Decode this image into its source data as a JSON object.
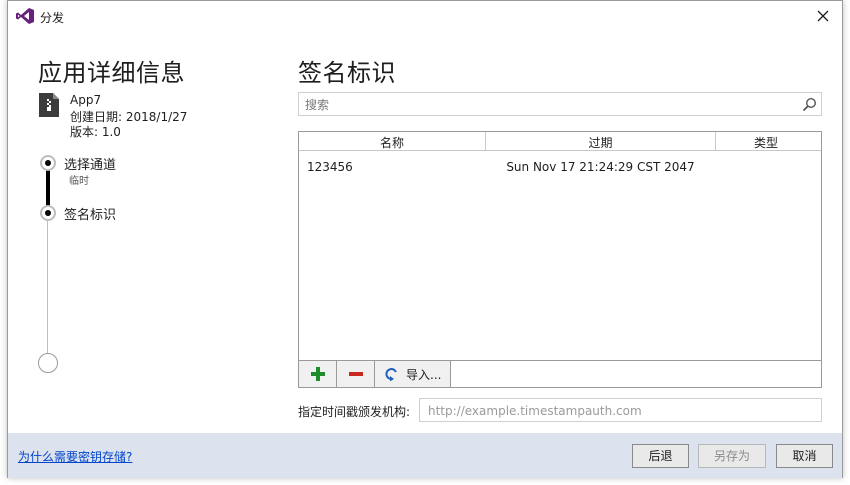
{
  "window": {
    "title": "分发",
    "close_icon": "close-icon"
  },
  "app_details": {
    "heading": "应用详细信息",
    "icon": "zip-file-icon",
    "name": "App7",
    "created": "创建日期: 2018/1/27",
    "version": "版本: 1.0"
  },
  "steps": [
    {
      "label": "选择通道",
      "sublabel": "临时",
      "state": "done"
    },
    {
      "label": "签名标识",
      "state": "current"
    },
    {
      "label": "",
      "state": "pending"
    }
  ],
  "signing": {
    "heading": "签名标识",
    "search_placeholder": "搜索",
    "columns": [
      "名称",
      "过期",
      "类型"
    ],
    "rows": [
      {
        "name": "123456",
        "expires": "Sun Nov 17 21:24:29 CST 2047",
        "type": ""
      }
    ],
    "toolbar": {
      "import_label": "导入..."
    },
    "tsa_label": "指定时间戳颁发机构:",
    "tsa_placeholder": "http://example.timestampauth.com"
  },
  "footer": {
    "help_link": "为什么需要密钥存储?",
    "back_label": "后退",
    "save_as_label": "另存为",
    "cancel_label": "取消"
  },
  "colors": {
    "accent_link": "#0044cc",
    "footer_bg": "#dce2ee",
    "add_green": "#1e8c28",
    "remove_red": "#c8281e",
    "vs_purple": "#68217a"
  }
}
